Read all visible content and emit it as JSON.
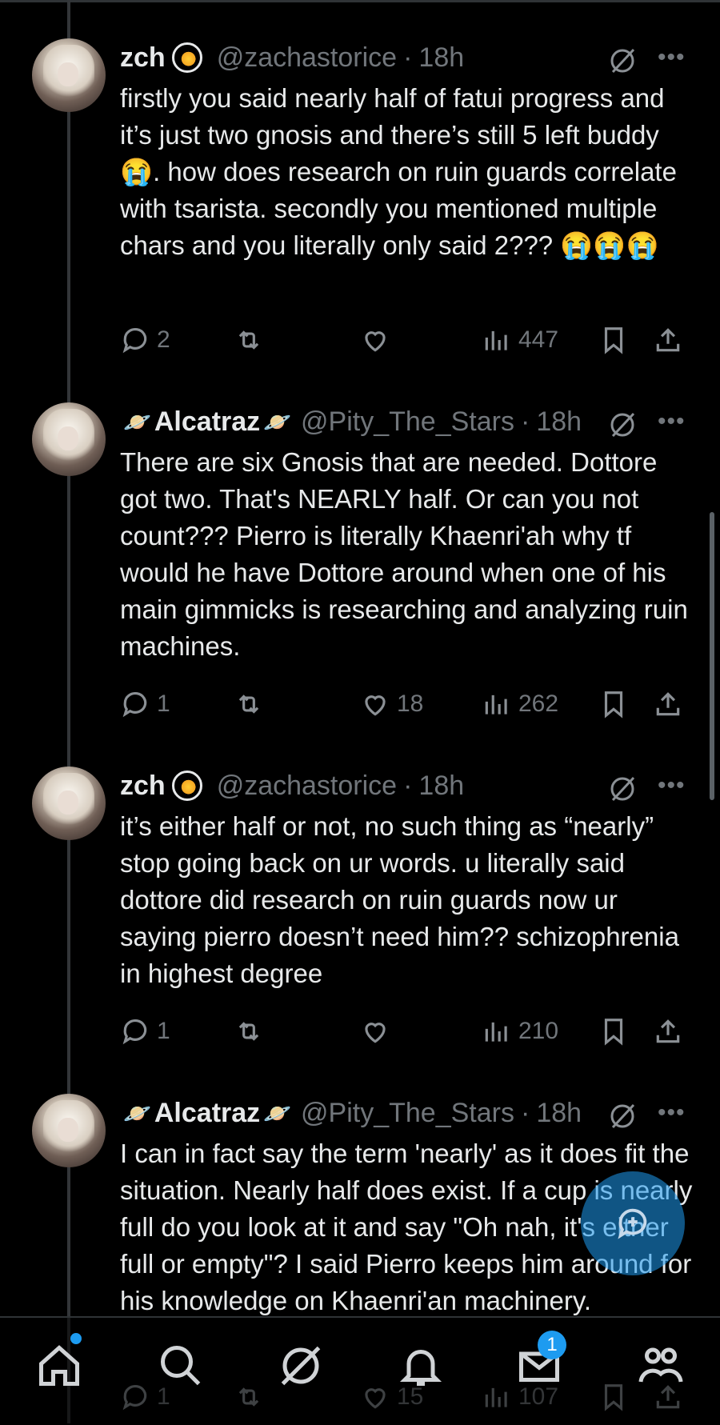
{
  "tweets": [
    {
      "name": "zch",
      "name_prefix": "",
      "name_suffix": "",
      "handle": "@zachastorice",
      "sep": "·",
      "time": "18h",
      "text": "firstly you said nearly half of fatui progress and it’s just two gnosis and there’s still 5 left buddy 😭. how does research on ruin guards correlate with tsarista. secondly you mentioned multiple chars and you literally only said 2??? 😭😭😭",
      "replies": "2",
      "reposts": "",
      "likes": "",
      "views": "447"
    },
    {
      "name": "Alcatraz",
      "name_prefix": "🪐",
      "name_suffix": "🪐",
      "handle": "@Pity_The_Stars",
      "sep": "·",
      "time": "18h",
      "text": "There are six Gnosis that are needed. Dottore got two. That's NEARLY half. Or can you not count??? Pierro is literally Khaenri'ah why tf would he have Dottore around when one of his main gimmicks is researching and analyzing ruin machines.",
      "replies": "1",
      "reposts": "",
      "likes": "18",
      "views": "262"
    },
    {
      "name": "zch",
      "name_prefix": "",
      "name_suffix": "",
      "handle": "@zachastorice",
      "sep": "·",
      "time": "18h",
      "text": "it’s either half or not, no such thing as “nearly” stop going back on ur words. u literally said dottore did research on ruin guards now ur saying pierro doesn’t need him?? schizophrenia in highest degree",
      "replies": "1",
      "reposts": "",
      "likes": "",
      "views": "210"
    },
    {
      "name": "Alcatraz",
      "name_prefix": "🪐",
      "name_suffix": "🪐",
      "handle": "@Pity_The_Stars",
      "sep": "·",
      "time": "18h",
      "text": "I can in fact say the term 'nearly' as it does fit the situation. Nearly half does exist. If a cup is nearly full do you look at it and say \"Oh nah, it's either full or empty\"? I said Pierro keeps him around for his knowledge on Khaenri'an machinery.",
      "replies": "1",
      "reposts": "",
      "likes": "15",
      "views": "107"
    }
  ],
  "nav": {
    "messages_badge": "1"
  },
  "colors": {
    "background": "#000000",
    "text": "#e7e9ea",
    "muted": "#71767b",
    "accent": "#1d9bf0"
  },
  "icons": [
    "reply-icon",
    "repost-icon",
    "like-icon",
    "views-icon",
    "bookmark-icon",
    "share-icon",
    "grok-icon",
    "more-icon",
    "home-icon",
    "search-icon",
    "notifications-icon",
    "messages-icon",
    "communities-icon",
    "compose-icon"
  ]
}
